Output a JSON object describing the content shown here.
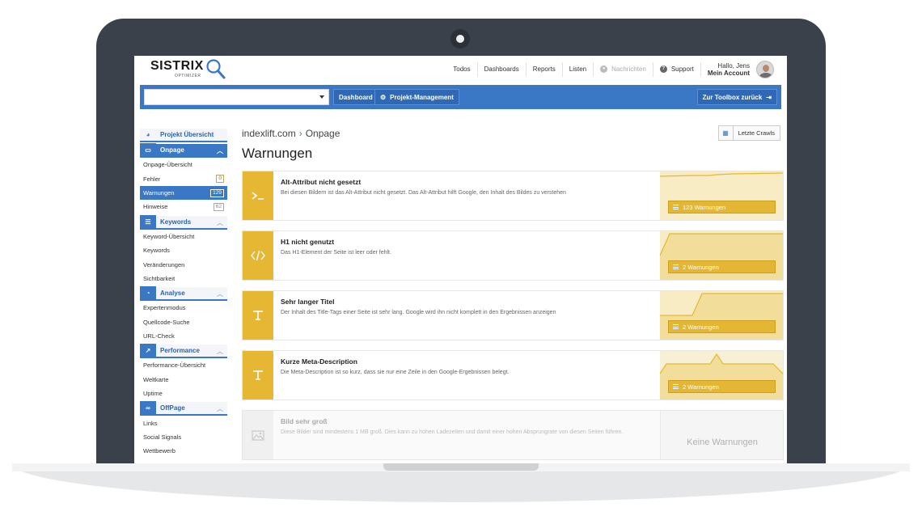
{
  "app": {
    "logo": "SISTRIX",
    "logo_sub": "OPTIMIZER"
  },
  "topnav": {
    "todos": "Todos",
    "dashboards": "Dashboards",
    "reports": "Reports",
    "listen": "Listen",
    "nachrichten": "Nachrichten",
    "support": "Support",
    "greeting": "Hallo, Jens",
    "account": "Mein Account"
  },
  "toolbar": {
    "select_value": "",
    "dashboard": "Dashboard",
    "projekt_management": "Projekt-Management",
    "zurueck": "Zur Toolbox zurück"
  },
  "sidebar": {
    "projekt": "Projekt Übersicht",
    "onpage": {
      "label": "Onpage",
      "items": [
        {
          "label": "Onpage-Übersicht"
        },
        {
          "label": "Fehler",
          "badge": "0"
        },
        {
          "label": "Warnungen",
          "badge": "129"
        },
        {
          "label": "Hinweise",
          "badge": "62"
        }
      ]
    },
    "keywords": {
      "label": "Keywords",
      "items": [
        {
          "label": "Keyword-Übersicht"
        },
        {
          "label": "Keywords"
        },
        {
          "label": "Veränderungen"
        },
        {
          "label": "Sichtbarkeit"
        }
      ]
    },
    "analyse": {
      "label": "Analyse",
      "items": [
        {
          "label": "Expertenmodus"
        },
        {
          "label": "Quellcode-Suche"
        },
        {
          "label": "URL-Check"
        }
      ]
    },
    "performance": {
      "label": "Performance",
      "items": [
        {
          "label": "Performance-Übersicht"
        },
        {
          "label": "Weltkarte"
        },
        {
          "label": "Uptime"
        }
      ]
    },
    "offpage": {
      "label": "OffPage",
      "items": [
        {
          "label": "Links"
        },
        {
          "label": "Social Signals"
        },
        {
          "label": "Wettbewerb"
        }
      ]
    }
  },
  "main": {
    "crumb_domain": "indexlift.com",
    "crumb_sep": "›",
    "crumb_section": "Onpage",
    "title": "Warnungen",
    "letzte_crawls": "Letzte Crawls",
    "cards": [
      {
        "icon": ">_",
        "title": "Alt-Attribut nicht gesetzt",
        "desc": "Bei diesen Bildern ist das Alt-Attribut nicht gesetzt. Das Alt-Attribut hilft Google, den Inhalt des Bildes zu verstehen",
        "button": "123 Warnungen"
      },
      {
        "icon": "</>",
        "title": "H1 nicht genutzt",
        "desc": "Das H1-Element der Seite ist leer oder fehlt.",
        "button": "2 Warnungen"
      },
      {
        "icon": "T",
        "title": "Sehr langer Titel",
        "desc": "Der Inhalt des Title-Tags einer Seite ist sehr lang. Google wird ihn nicht komplett in den Ergebnissen anzeigen",
        "button": "2 Warnungen"
      },
      {
        "icon": "T",
        "title": "Kurze Meta-Description",
        "desc": "Die Meta-Description ist so kurz, dass sie nur eine Zeile in den Google-Ergebnissen belegt.",
        "button": "2 Warnungen"
      },
      {
        "icon": "image",
        "title": "Bild sehr groß",
        "desc": "Diese Bilder sind mindestens 1 MB groß. Dies kann zu hohen Ladezeiten und damit einer hohen Absprungrate von diesen Seiten führen.",
        "button": "Keine Warnungen"
      }
    ]
  },
  "colors": {
    "brand_blue": "#3a78c6",
    "warning_yellow": "#e6b733",
    "chart_fill": "#f7ecc4"
  }
}
